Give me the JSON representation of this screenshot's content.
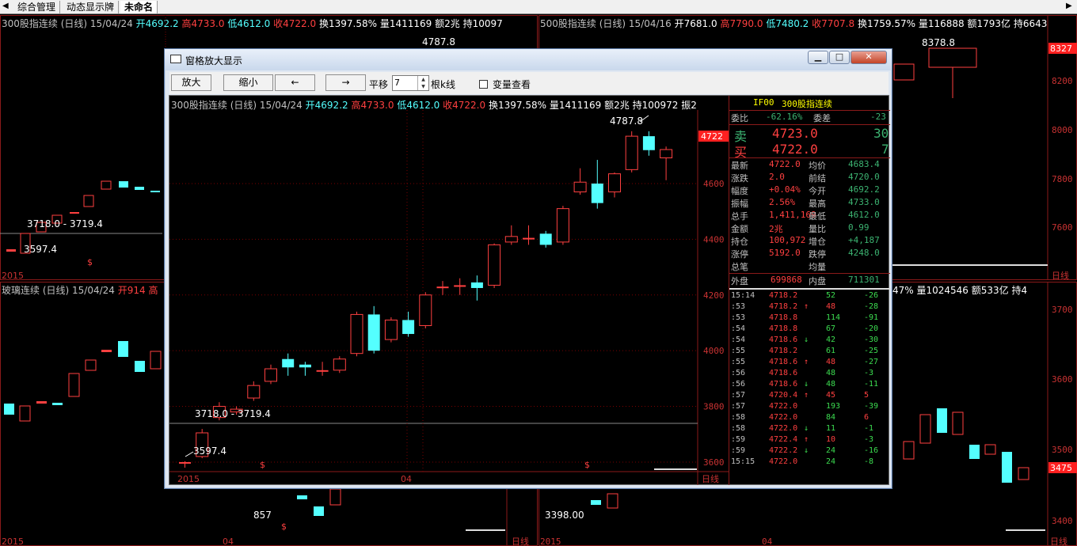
{
  "tabs": {
    "nav_left": "◀",
    "nav_right": "▶",
    "items": [
      "综合管理",
      "动态显示牌",
      "未命名"
    ]
  },
  "top_left": {
    "title": "300股指连续 (日线)",
    "date": "15/04/24",
    "open": "开4692.2",
    "high": "高4733.0",
    "low": "低4612.0",
    "close": "收4722.0",
    "turn": "换1397.58%",
    "vol": "量1411169",
    "amt": "额2兆",
    "hold": "持10097",
    "hi_label": "4787.8",
    "range_label": "3718.0 - 3719.4",
    "lo_label": "3597.4",
    "year": "2015"
  },
  "top_right": {
    "title": "500股指连续 (日线)",
    "date": "15/04/16",
    "open": "开7681.0",
    "high": "高7790.0",
    "low": "低7480.2",
    "close": "收7707.8",
    "turn": "换1759.57%",
    "vol": "量116888",
    "amt": "额1793亿",
    "hold": "持6643",
    "hi_label": "8378.8",
    "price_tag": "8327",
    "axis": [
      "8200",
      "8000",
      "7800",
      "7600"
    ],
    "period": "日线"
  },
  "bottom_left": {
    "title": "玻璃连续 (日线)",
    "date": "15/04/24",
    "open": "开914",
    "high": "高",
    "lo_label": "857",
    "year": "2015",
    "month": "04"
  },
  "bottom_right": {
    "info": "47% 量1024546 额533亿 持4",
    "lo_label": "3398.00",
    "price_tag": "3475",
    "axis": [
      "3700",
      "3600",
      "3500",
      "3400"
    ],
    "year": "2015",
    "month": "04",
    "period": "日线"
  },
  "bottom_mid": {
    "period": "日线"
  },
  "dialog": {
    "title": "窗格放大显示",
    "buttons": {
      "zoom_in": "放大",
      "zoom_out": "缩小",
      "left": "←",
      "right": "→"
    },
    "shift_label": "平移",
    "shift_value": "7",
    "bars_label": "根k线",
    "var_label": "变量查看",
    "win": {
      "min": "▁",
      "max": "□",
      "close": "✕"
    }
  },
  "main_chart": {
    "header": {
      "title": "300股指连续 (日线)",
      "date": "15/04/24",
      "open": "开4692.2",
      "high": "高4733.0",
      "low": "低4612.0",
      "close": "收4722.0",
      "turn": "换1397.58%",
      "vol": "量1411169",
      "amt": "额2兆",
      "hold": "持100972",
      "amp": "振2"
    },
    "hi_label": "4787.8",
    "range_label": "3718.0 - 3719.4",
    "lo_label": "3597.4",
    "price_tag": "4722",
    "year": "2015",
    "month": "04",
    "period": "日线",
    "marker": "$"
  },
  "chart_data": {
    "type": "candlestick",
    "title": "300股指连续 (日线)",
    "ylim": [
      3580,
      4830
    ],
    "yticks": [
      3600,
      3800,
      4000,
      4200,
      4400,
      4600
    ],
    "candles": [
      {
        "o": 3597,
        "c": 3600,
        "h": 3603,
        "l": 3580
      },
      {
        "o": 3620,
        "c": 3705,
        "h": 3719,
        "l": 3614
      },
      {
        "o": 3760,
        "c": 3800,
        "h": 3815,
        "l": 3750
      },
      {
        "o": 3780,
        "c": 3790,
        "h": 3800,
        "l": 3770
      },
      {
        "o": 3830,
        "c": 3875,
        "h": 3890,
        "l": 3820
      },
      {
        "o": 3890,
        "c": 3935,
        "h": 3950,
        "l": 3880
      },
      {
        "o": 3970,
        "c": 3940,
        "h": 3990,
        "l": 3910
      },
      {
        "o": 3950,
        "c": 3940,
        "h": 3960,
        "l": 3910
      },
      {
        "o": 3930,
        "c": 3930,
        "h": 3960,
        "l": 3910
      },
      {
        "o": 3930,
        "c": 3970,
        "h": 3980,
        "l": 3920
      },
      {
        "o": 3990,
        "c": 4130,
        "h": 4140,
        "l": 3980
      },
      {
        "o": 4130,
        "c": 4000,
        "h": 4160,
        "l": 3990
      },
      {
        "o": 4040,
        "c": 4110,
        "h": 4120,
        "l": 4030
      },
      {
        "o": 4110,
        "c": 4060,
        "h": 4140,
        "l": 4050
      },
      {
        "o": 4090,
        "c": 4200,
        "h": 4210,
        "l": 4080
      },
      {
        "o": 4230,
        "c": 4230,
        "h": 4250,
        "l": 4200
      },
      {
        "o": 4230,
        "c": 4235,
        "h": 4260,
        "l": 4200
      },
      {
        "o": 4245,
        "c": 4225,
        "h": 4270,
        "l": 4180
      },
      {
        "o": 4235,
        "c": 4380,
        "h": 4385,
        "l": 4225
      },
      {
        "o": 4390,
        "c": 4410,
        "h": 4450,
        "l": 4380
      },
      {
        "o": 4405,
        "c": 4405,
        "h": 4450,
        "l": 4380
      },
      {
        "o": 4420,
        "c": 4380,
        "h": 4430,
        "l": 4370
      },
      {
        "o": 4390,
        "c": 4510,
        "h": 4520,
        "l": 4380
      },
      {
        "o": 4570,
        "c": 4605,
        "h": 4655,
        "l": 4560
      },
      {
        "o": 4600,
        "c": 4530,
        "h": 4685,
        "l": 4510
      },
      {
        "o": 4570,
        "c": 4635,
        "h": 4640,
        "l": 4550
      },
      {
        "o": 4650,
        "c": 4770,
        "h": 4787.8,
        "l": 4640
      },
      {
        "o": 4770,
        "c": 4720,
        "h": 4787.8,
        "l": 4700
      },
      {
        "o": 4692.2,
        "c": 4722,
        "h": 4733,
        "l": 4612
      }
    ],
    "labels": [
      "4787.8",
      "3718.0 - 3719.4",
      "3597.4"
    ],
    "xlabels": [
      "2015",
      "04"
    ]
  },
  "quote": {
    "code": "IF00",
    "name": "300股指连续",
    "webi_label": "委比",
    "webi": "-62.16%",
    "wecha_label": "委差",
    "wecha": "-23",
    "sell_label": "卖",
    "sell_price": "4723.0",
    "sell_vol": "30",
    "buy_label": "买",
    "buy_price": "4722.0",
    "buy_vol": "7",
    "rows": [
      {
        "l1": "最新",
        "v1": "4722.0",
        "l2": "均价",
        "v2": "4683.4"
      },
      {
        "l1": "涨跌",
        "v1": "2.0",
        "l2": "前结",
        "v2": "4720.0"
      },
      {
        "l1": "幅度",
        "v1": "+0.04%",
        "l2": "今开",
        "v2": "4692.2"
      },
      {
        "l1": "振幅",
        "v1": "2.56%",
        "l2": "最高",
        "v2": "4733.0"
      },
      {
        "l1": "总手",
        "v1": "1,411,169",
        "l2": "最低",
        "v2": "4612.0"
      },
      {
        "l1": "金额",
        "v1": "2兆",
        "l2": "量比",
        "v2": "0.99"
      },
      {
        "l1": "持仓",
        "v1": "100,972",
        "l2": "增仓",
        "v2": "+4,187"
      },
      {
        "l1": "涨停",
        "v1": "5192.0",
        "l2": "跌停",
        "v2": "4248.0"
      },
      {
        "l1": "总笔",
        "v1": "",
        "l2": "均量",
        "v2": ""
      }
    ],
    "outer_label": "外盘",
    "outer": "699868",
    "inner_label": "内盘",
    "inner": "711301"
  },
  "ticks": [
    {
      "t": "15:14",
      "p": "4718.2",
      "a": "",
      "v": "52",
      "d": "-26"
    },
    {
      "t": ":53",
      "p": "4718.2",
      "a": "↑",
      "v": "48",
      "d": "-28"
    },
    {
      "t": ":53",
      "p": "4718.8",
      "a": "",
      "v": "114",
      "d": "-91"
    },
    {
      "t": ":54",
      "p": "4718.8",
      "a": "",
      "v": "67",
      "d": "-20"
    },
    {
      "t": ":54",
      "p": "4718.6",
      "a": "↓",
      "v": "42",
      "d": "-30"
    },
    {
      "t": ":55",
      "p": "4718.2",
      "a": "",
      "v": "61",
      "d": "-25"
    },
    {
      "t": ":55",
      "p": "4718.6",
      "a": "↑",
      "v": "48",
      "d": "-27"
    },
    {
      "t": ":56",
      "p": "4718.6",
      "a": "",
      "v": "48",
      "d": "-3"
    },
    {
      "t": ":56",
      "p": "4718.6",
      "a": "↓",
      "v": "48",
      "d": "-11"
    },
    {
      "t": ":57",
      "p": "4720.4",
      "a": "↑",
      "v": "45",
      "d": "5"
    },
    {
      "t": ":57",
      "p": "4722.0",
      "a": "",
      "v": "193",
      "d": "-39"
    },
    {
      "t": ":58",
      "p": "4722.0",
      "a": "",
      "v": "84",
      "d": "6"
    },
    {
      "t": ":58",
      "p": "4722.0",
      "a": "↓",
      "v": "11",
      "d": "-1"
    },
    {
      "t": ":59",
      "p": "4722.4",
      "a": "↑",
      "v": "10",
      "d": "-3"
    },
    {
      "t": ":59",
      "p": "4722.2",
      "a": "↓",
      "v": "24",
      "d": "-16"
    },
    {
      "t": "15:15",
      "p": "4722.0",
      "a": "",
      "v": "24",
      "d": "-8"
    }
  ],
  "colors": {
    "up": "#ff4040",
    "down": "#54ffff",
    "grid": "#7a0000"
  }
}
